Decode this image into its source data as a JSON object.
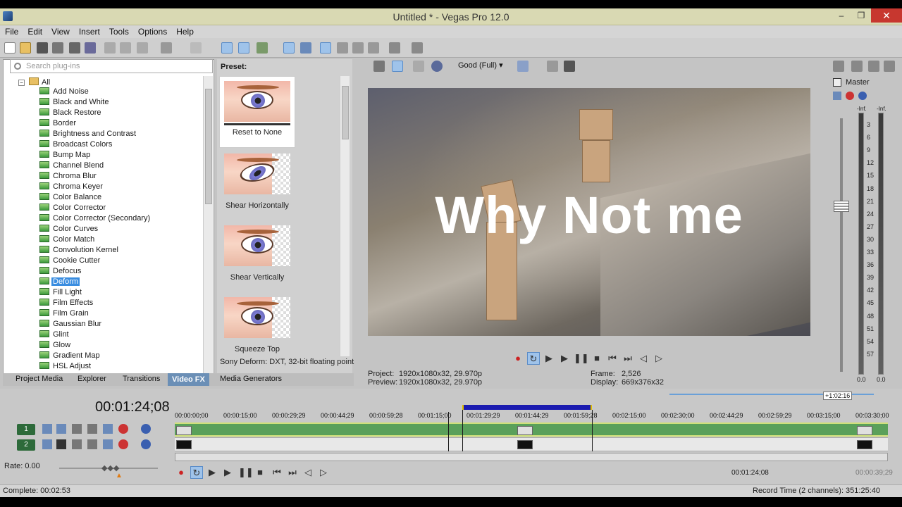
{
  "window": {
    "title": "Untitled * - Vegas Pro 12.0",
    "minimize": "–",
    "maximize": "❐",
    "close": "✕"
  },
  "menu": [
    "File",
    "Edit",
    "View",
    "Insert",
    "Tools",
    "Options",
    "Help"
  ],
  "fx_panel": {
    "search_placeholder": "Search plug-ins",
    "root": "All",
    "items": [
      "Add Noise",
      "Black and White",
      "Black Restore",
      "Border",
      "Brightness and Contrast",
      "Broadcast Colors",
      "Bump Map",
      "Channel Blend",
      "Chroma Blur",
      "Chroma Keyer",
      "Color Balance",
      "Color Corrector",
      "Color Corrector (Secondary)",
      "Color Curves",
      "Color Match",
      "Convolution Kernel",
      "Cookie Cutter",
      "Defocus",
      "Deform",
      "Fill Light",
      "Film Effects",
      "Film Grain",
      "Gaussian Blur",
      "Glint",
      "Glow",
      "Gradient Map",
      "HSL Adjust"
    ],
    "selected": "Deform"
  },
  "preset_panel": {
    "heading": "Preset:",
    "presets": [
      "Reset to None",
      "Shear Horizontally",
      "Shear Vertically",
      "Squeeze Top"
    ],
    "description": "Sony Deform: DXT, 32-bit floating point"
  },
  "tabs": [
    "Project Media",
    "Explorer",
    "Transitions",
    "Video FX",
    "Media Generators"
  ],
  "active_tab": "Video FX",
  "preview": {
    "quality": "Good (Full)",
    "overlay_text": "Why Not me",
    "project_label": "Project:",
    "project_value": "1920x1080x32, 29.970p",
    "preview_label": "Preview:",
    "preview_value": "1920x1080x32, 29.970p",
    "frame_label": "Frame:",
    "frame_value": "2,526",
    "display_label": "Display:",
    "display_value": "669x376x32"
  },
  "mixer": {
    "master": "Master",
    "inf_left": "-Inf.",
    "inf_right": "-Inf.",
    "scale": [
      "3",
      "6",
      "9",
      "12",
      "15",
      "18",
      "21",
      "24",
      "27",
      "30",
      "33",
      "36",
      "39",
      "42",
      "45",
      "48",
      "51",
      "54",
      "57"
    ],
    "bottom_left": "0.0",
    "bottom_right": "0.0"
  },
  "timeline": {
    "timecode": "00:01:24;08",
    "ruler": [
      "00:00:00;00",
      "00:00:15;00",
      "00:00:29;29",
      "00:00:44;29",
      "00:00:59;28",
      "00:01:15;00",
      "00:01:29;29",
      "00:01:44;29",
      "00:01:59;28",
      "00:02:15;00",
      "00:02:30;00",
      "00:02:44;29",
      "00:02:59;29",
      "00:03:15;00",
      "00:03:30;00"
    ],
    "mini_label": "+1:02:16",
    "track1": "1",
    "track2": "2",
    "rate": "Rate: 0.00",
    "cursor_time": "00:01:24;08",
    "length_time": "00:00:39;29"
  },
  "status": {
    "left": "Complete: 00:02:53",
    "right": "Record Time (2 channels): 351:25:40"
  },
  "colors": {
    "titlebar": "#d9d9b3",
    "selection": "#3a8de0",
    "close": "#c7372f",
    "loop": "#1b1bb0"
  }
}
